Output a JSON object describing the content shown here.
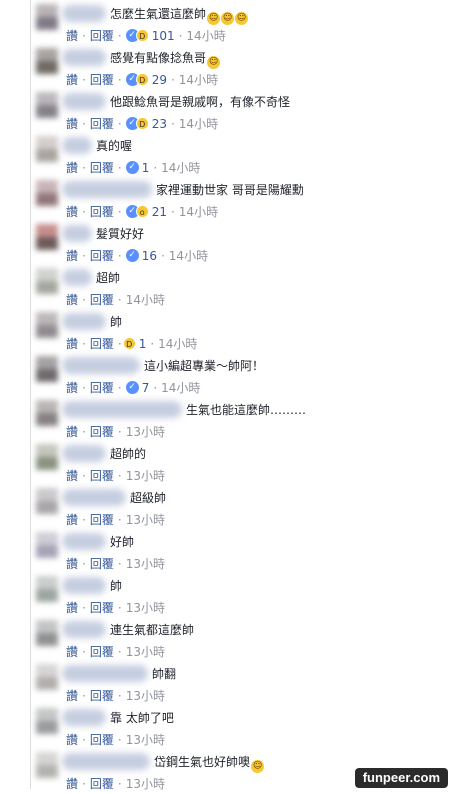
{
  "labels": {
    "like": "讚",
    "reply": "回覆",
    "sep": "·"
  },
  "comments": [
    {
      "text": "怎麼生氣還這麼帥",
      "emojis": [
        "😂",
        "😂",
        "😂"
      ],
      "reactions": [
        "like",
        "haha"
      ],
      "count": "101",
      "time": "14小時"
    },
    {
      "text": "感覺有點像捻魚哥",
      "emojis": [
        "😂"
      ],
      "reactions": [
        "like",
        "haha"
      ],
      "count": "29",
      "time": "14小時"
    },
    {
      "text": "他跟鯰魚哥是親戚啊，有像不奇怪",
      "emojis": [],
      "reactions": [
        "like",
        "haha"
      ],
      "count": "23",
      "time": "14小時"
    },
    {
      "text": "真的喔",
      "emojis": [],
      "reactions": [
        "like"
      ],
      "count": "1",
      "time": "14小時"
    },
    {
      "text": "家裡運動世家 哥哥是陽耀勳",
      "emojis": [],
      "reactions": [
        "like",
        "wow"
      ],
      "count": "21",
      "time": "14小時"
    },
    {
      "text": "髮質好好",
      "emojis": [],
      "reactions": [
        "like"
      ],
      "count": "16",
      "time": "14小時"
    },
    {
      "text": "超帥",
      "emojis": [],
      "reactions": [],
      "count": "",
      "time": "14小時"
    },
    {
      "text": "帥",
      "emojis": [],
      "reactions": [
        "haha"
      ],
      "count": "1",
      "time": "14小時"
    },
    {
      "text": "這小編超專業～帥阿！",
      "emojis": [],
      "reactions": [
        "like"
      ],
      "count": "7",
      "time": "14小時"
    },
    {
      "text": "生氣也能這麼帥………",
      "emojis": [],
      "reactions": [],
      "count": "",
      "time": "13小時"
    },
    {
      "text": "超帥的",
      "emojis": [],
      "reactions": [],
      "count": "",
      "time": "13小時"
    },
    {
      "text": "超級帥",
      "emojis": [],
      "reactions": [],
      "count": "",
      "time": "13小時"
    },
    {
      "text": "好帥",
      "emojis": [],
      "reactions": [],
      "count": "",
      "time": "13小時"
    },
    {
      "text": "帥",
      "emojis": [],
      "reactions": [],
      "count": "",
      "time": "13小時"
    },
    {
      "text": "連生氣都這麼帥",
      "emojis": [],
      "reactions": [],
      "count": "",
      "time": "13小時"
    },
    {
      "text": "帥翻",
      "emojis": [],
      "reactions": [],
      "count": "",
      "time": "13小時"
    },
    {
      "text": "靠 太帥了吧",
      "emojis": [],
      "reactions": [],
      "count": "",
      "time": "13小時"
    },
    {
      "text": "岱鋼生氣也好帥噢",
      "emojis": [
        "😂"
      ],
      "reactions": [],
      "count": "",
      "time": "13小時"
    }
  ],
  "watermark": "funpeer.com",
  "colors": {
    "link": "#365899",
    "muted": "#90949c",
    "like_blue": "#5890ff",
    "haha_yellow": "#f7c631"
  }
}
